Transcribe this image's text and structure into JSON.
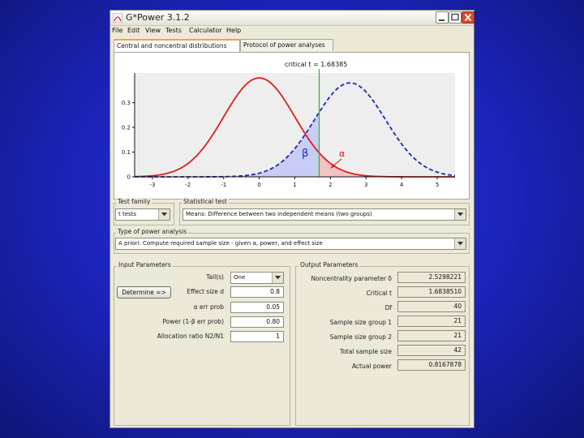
{
  "window": {
    "title": "G*Power 3.1.2"
  },
  "menu": [
    "File",
    "Edit",
    "View",
    "Tests",
    "Calculator",
    "Help"
  ],
  "tabs": [
    "Central and noncentral distributions",
    "Protocol of power analyses"
  ],
  "plot": {
    "critical_label": "critical t = 1.68385",
    "beta_label": "β",
    "alpha_label": "α",
    "colors": {
      "central": "#e01f1f",
      "noncentral": "#1a2bb4",
      "critical": "#19c219",
      "beta_fill": "#c9ccf4",
      "alpha_fill": "#f6c4c0"
    }
  },
  "chart_data": {
    "type": "line",
    "title": "critical t = 1.68385",
    "xlim": [
      -3.5,
      5.5
    ],
    "ylim": [
      0,
      0.42
    ],
    "x_ticks": [
      -3,
      -2,
      -1,
      0,
      1,
      2,
      3,
      4,
      5
    ],
    "y_ticks": [
      0,
      0.1,
      0.2,
      0.3
    ],
    "y_tick_labels": [
      "0",
      "0.1",
      "0.2",
      "0.3"
    ],
    "critical_t": 1.68385,
    "noncentrality": 2.55,
    "series": [
      {
        "kind": "central",
        "style": "solid",
        "peak_x": 0,
        "peak_y": 0.4
      },
      {
        "kind": "noncentral",
        "style": "dashed",
        "peak_x": 2.55,
        "peak_y": 0.38
      }
    ]
  },
  "test_family": {
    "label": "Test family",
    "value": "t tests"
  },
  "statistical_test": {
    "label": "Statistical test",
    "value": "Means: Difference between two independent means (two groups)"
  },
  "power_analysis": {
    "label": "Type of power analysis",
    "value": "A priori: Compute required sample size - given α, power, and effect size"
  },
  "input": {
    "label": "Input Parameters",
    "determine_button": "Determine =>",
    "rows": [
      {
        "label": "Tail(s)",
        "value": "One",
        "kind": "combo"
      },
      {
        "label": "Effect size d",
        "value": "0.8"
      },
      {
        "label": "α err prob",
        "value": "0.05"
      },
      {
        "label": "Power (1-β err prob)",
        "value": "0.80"
      },
      {
        "label": "Allocation ratio N2/N1",
        "value": "1"
      }
    ]
  },
  "output": {
    "label": "Output Parameters",
    "rows": [
      {
        "label": "Noncentrality parameter δ",
        "value": "2.5298221"
      },
      {
        "label": "Critical t",
        "value": "1.6838510"
      },
      {
        "label": "Df",
        "value": "40"
      },
      {
        "label": "Sample size group 1",
        "value": "21"
      },
      {
        "label": "Sample size group 2",
        "value": "21"
      },
      {
        "label": "Total sample size",
        "value": "42"
      },
      {
        "label": "Actual power",
        "value": "0.8167878"
      }
    ]
  }
}
